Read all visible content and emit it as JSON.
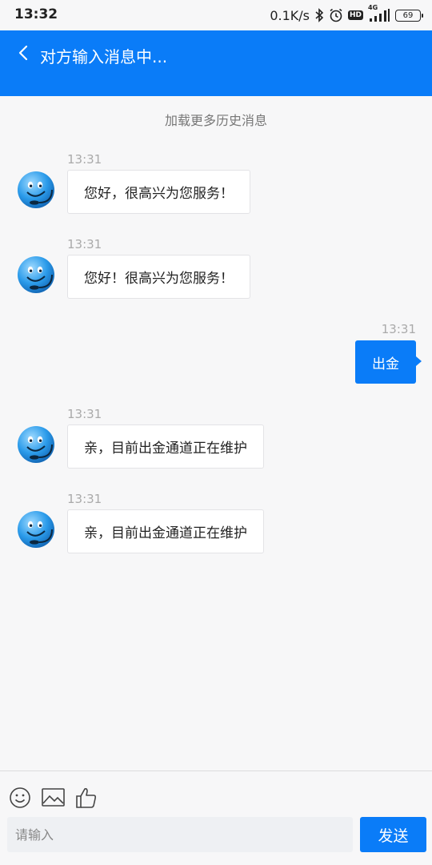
{
  "status_bar": {
    "time": "13:32",
    "network_speed": "0.1K/s",
    "hd_label": "HD",
    "signal_label": "4G",
    "battery": "69"
  },
  "header": {
    "title": "对方输入消息中..."
  },
  "chat": {
    "load_more": "加载更多历史消息",
    "messages": [
      {
        "side": "left",
        "time": "13:31",
        "text": "您好，很高兴为您服务！"
      },
      {
        "side": "left",
        "time": "13:31",
        "text": "您好！很高兴为您服务！"
      },
      {
        "side": "right",
        "time": "13:31",
        "text": "出金"
      },
      {
        "side": "left",
        "time": "13:31",
        "text": "亲，目前出金通道正在维护"
      },
      {
        "side": "left",
        "time": "13:31",
        "text": "亲，目前出金通道正在维护"
      }
    ]
  },
  "composer": {
    "placeholder": "请输入",
    "send_label": "发送",
    "tools": [
      "smiley-icon",
      "image-icon",
      "thumbs-up-icon"
    ]
  },
  "colors": {
    "accent": "#0a7cf8",
    "background": "#f7f7f8",
    "bubble": "#ffffff",
    "timestamp": "#aaaaaa"
  }
}
